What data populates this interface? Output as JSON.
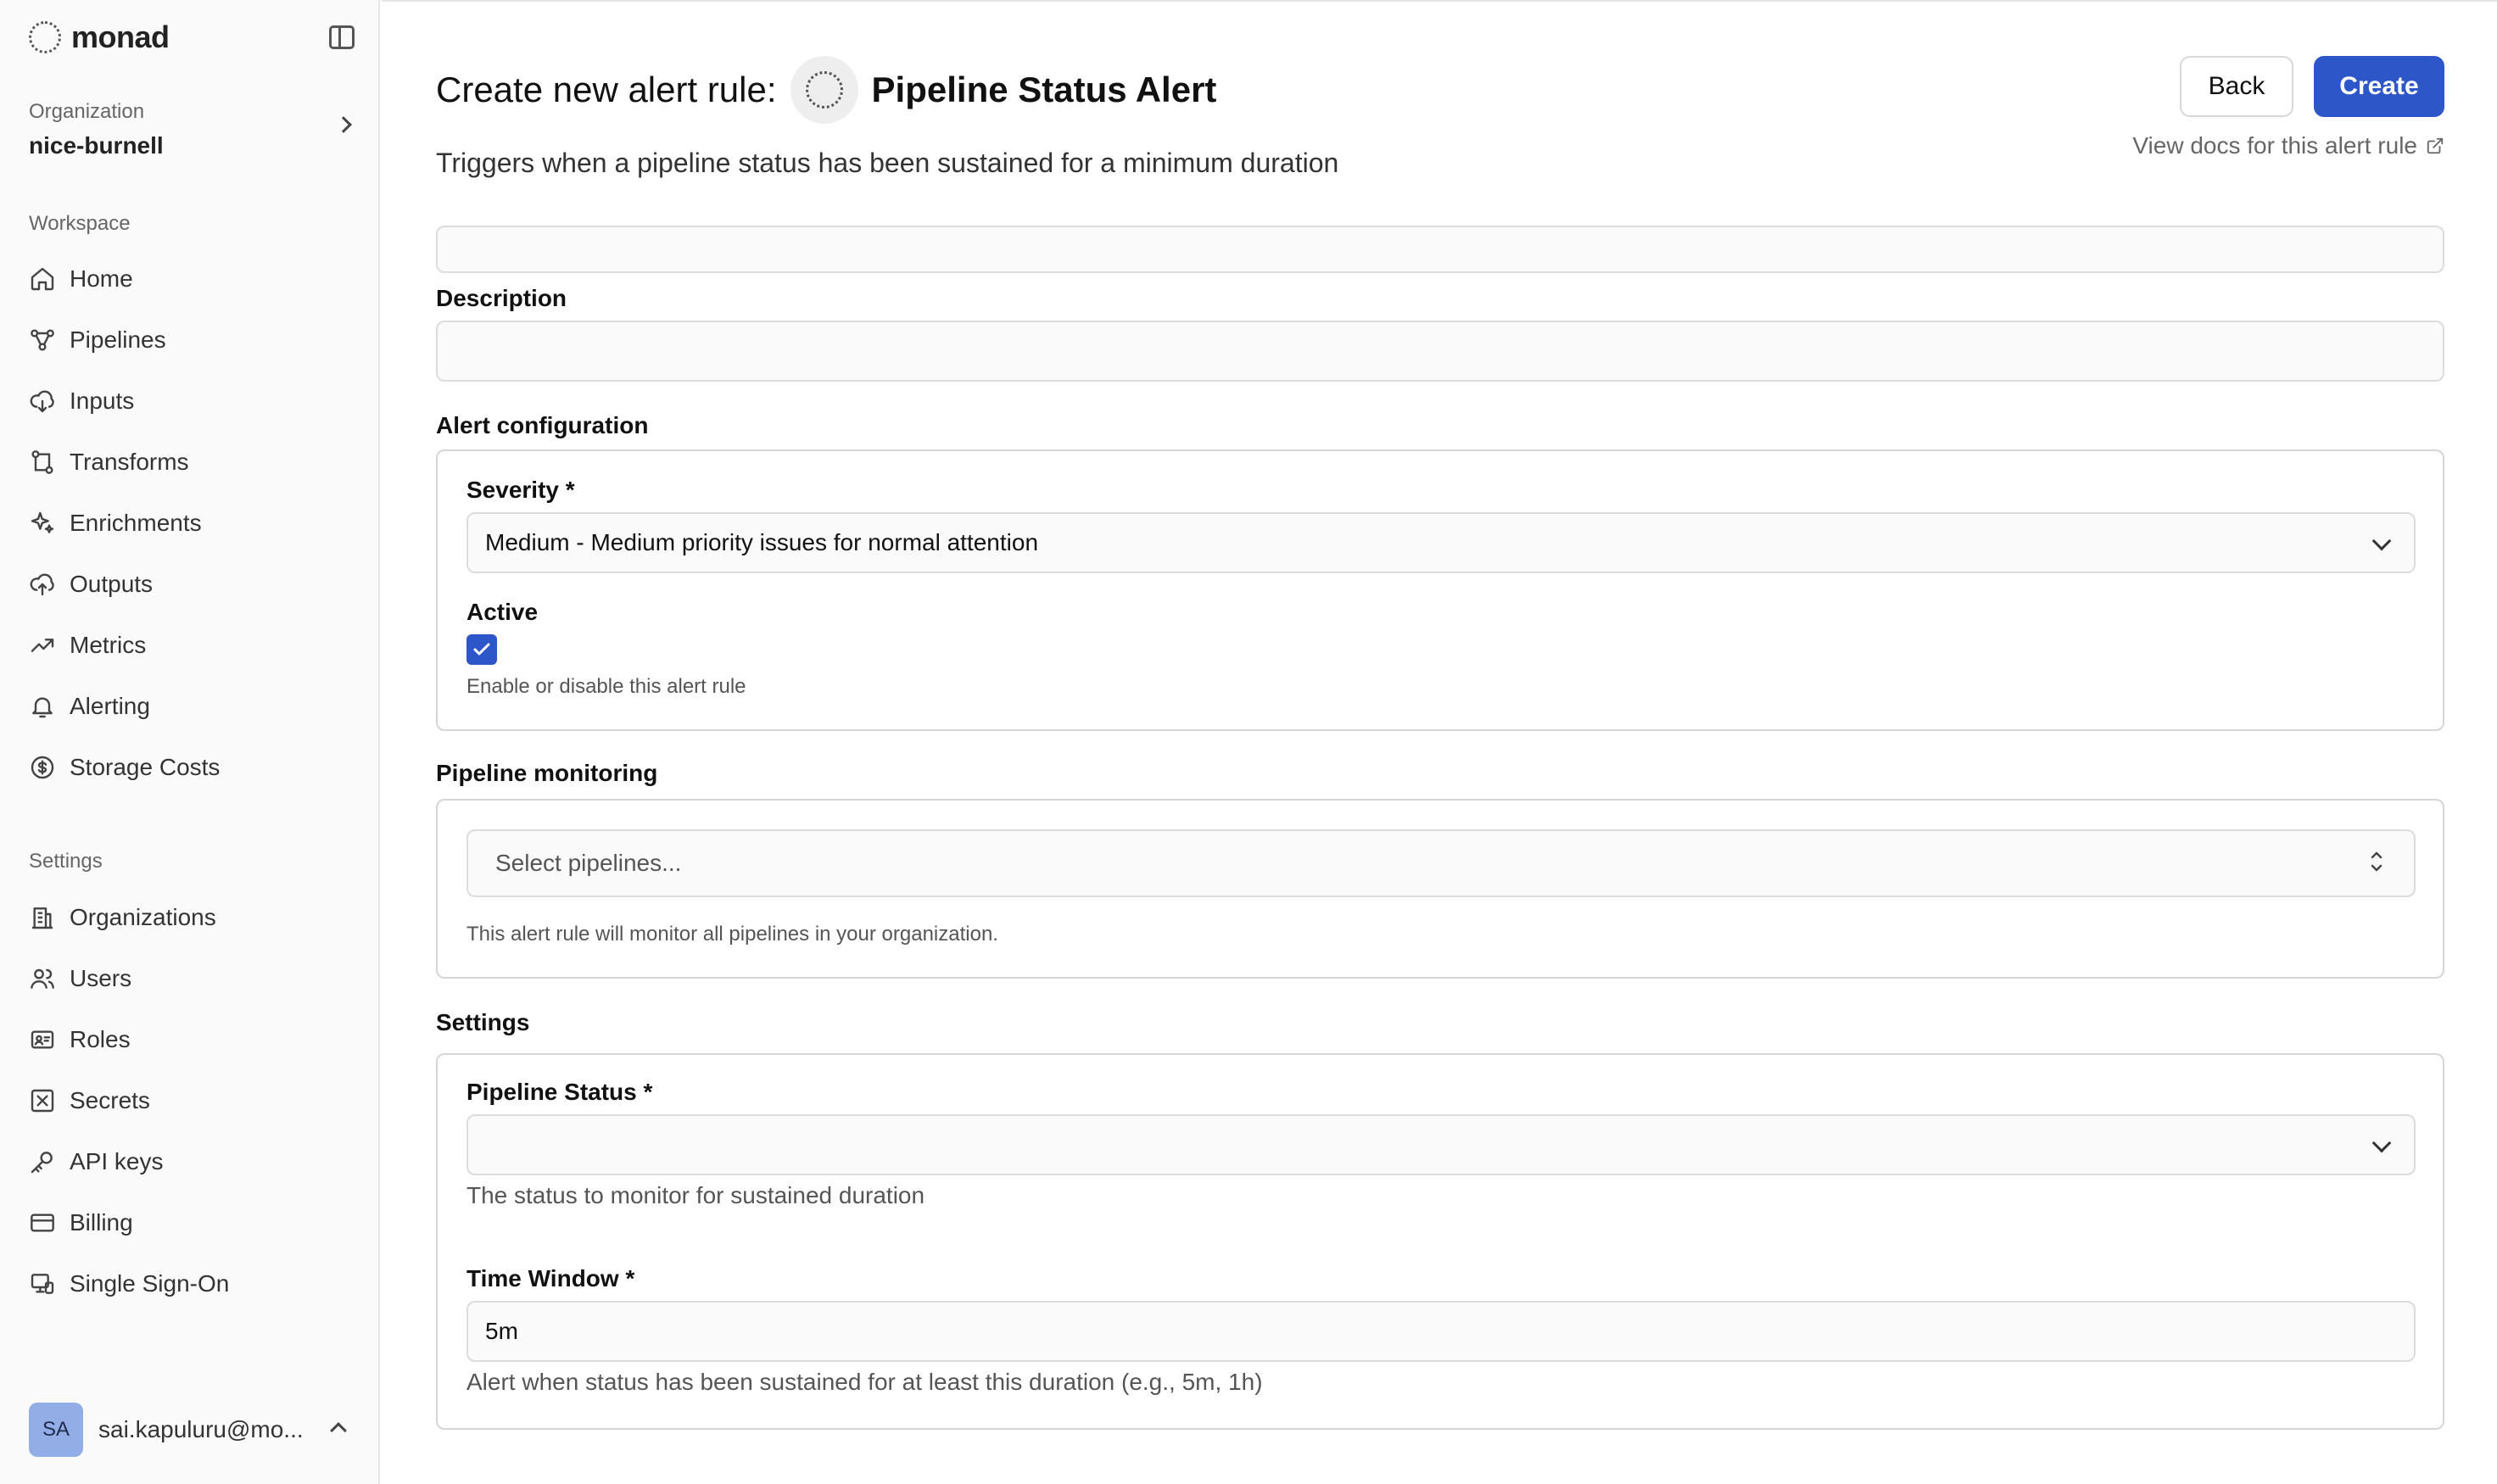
{
  "app": {
    "name": "monad"
  },
  "sidebar": {
    "org_label": "Organization",
    "org_name": "nice-burnell",
    "workspace_heading": "Workspace",
    "workspace_items": [
      {
        "label": "Home",
        "icon": "home-icon"
      },
      {
        "label": "Pipelines",
        "icon": "pipelines-icon"
      },
      {
        "label": "Inputs",
        "icon": "cloud-download-icon"
      },
      {
        "label": "Transforms",
        "icon": "git-branch-icon"
      },
      {
        "label": "Enrichments",
        "icon": "sparkles-icon"
      },
      {
        "label": "Outputs",
        "icon": "cloud-upload-icon"
      },
      {
        "label": "Metrics",
        "icon": "trending-up-icon"
      },
      {
        "label": "Alerting",
        "icon": "bell-icon"
      },
      {
        "label": "Storage Costs",
        "icon": "dollar-circle-icon"
      }
    ],
    "settings_heading": "Settings",
    "settings_items": [
      {
        "label": "Organizations",
        "icon": "building-icon"
      },
      {
        "label": "Users",
        "icon": "users-icon"
      },
      {
        "label": "Roles",
        "icon": "id-card-icon"
      },
      {
        "label": "Secrets",
        "icon": "lock-box-icon"
      },
      {
        "label": "API keys",
        "icon": "key-icon"
      },
      {
        "label": "Billing",
        "icon": "credit-card-icon"
      },
      {
        "label": "Single Sign-On",
        "icon": "sso-icon"
      }
    ],
    "user": {
      "initials": "SA",
      "email": "sai.kapuluru@mo..."
    }
  },
  "header": {
    "title_prefix": "Create new alert rule:",
    "title_name": "Pipeline Status Alert",
    "subtitle": "Triggers when a pipeline status has been sustained for a minimum duration",
    "back_label": "Back",
    "create_label": "Create",
    "docs_link": "View docs for this alert rule"
  },
  "form": {
    "name_value": "",
    "description_label": "Description",
    "description_value": "",
    "alert_config": {
      "section_title": "Alert configuration",
      "severity_label": "Severity *",
      "severity_value": "Medium - Medium priority issues for normal attention",
      "active_label": "Active",
      "active_checked": true,
      "active_hint": "Enable or disable this alert rule"
    },
    "pipeline_monitoring": {
      "section_title": "Pipeline monitoring",
      "select_placeholder": "Select pipelines...",
      "hint": "This alert rule will monitor all pipelines in your organization."
    },
    "settings": {
      "section_title": "Settings",
      "status_label": "Pipeline Status *",
      "status_value": "",
      "status_hint": "The status to monitor for sustained duration",
      "time_window_label": "Time Window *",
      "time_window_value": "5m",
      "time_window_hint": "Alert when status has been sustained for at least this duration (e.g., 5m, 1h)"
    }
  },
  "colors": {
    "primary": "#2d56c9",
    "avatar": "#93aee6"
  }
}
